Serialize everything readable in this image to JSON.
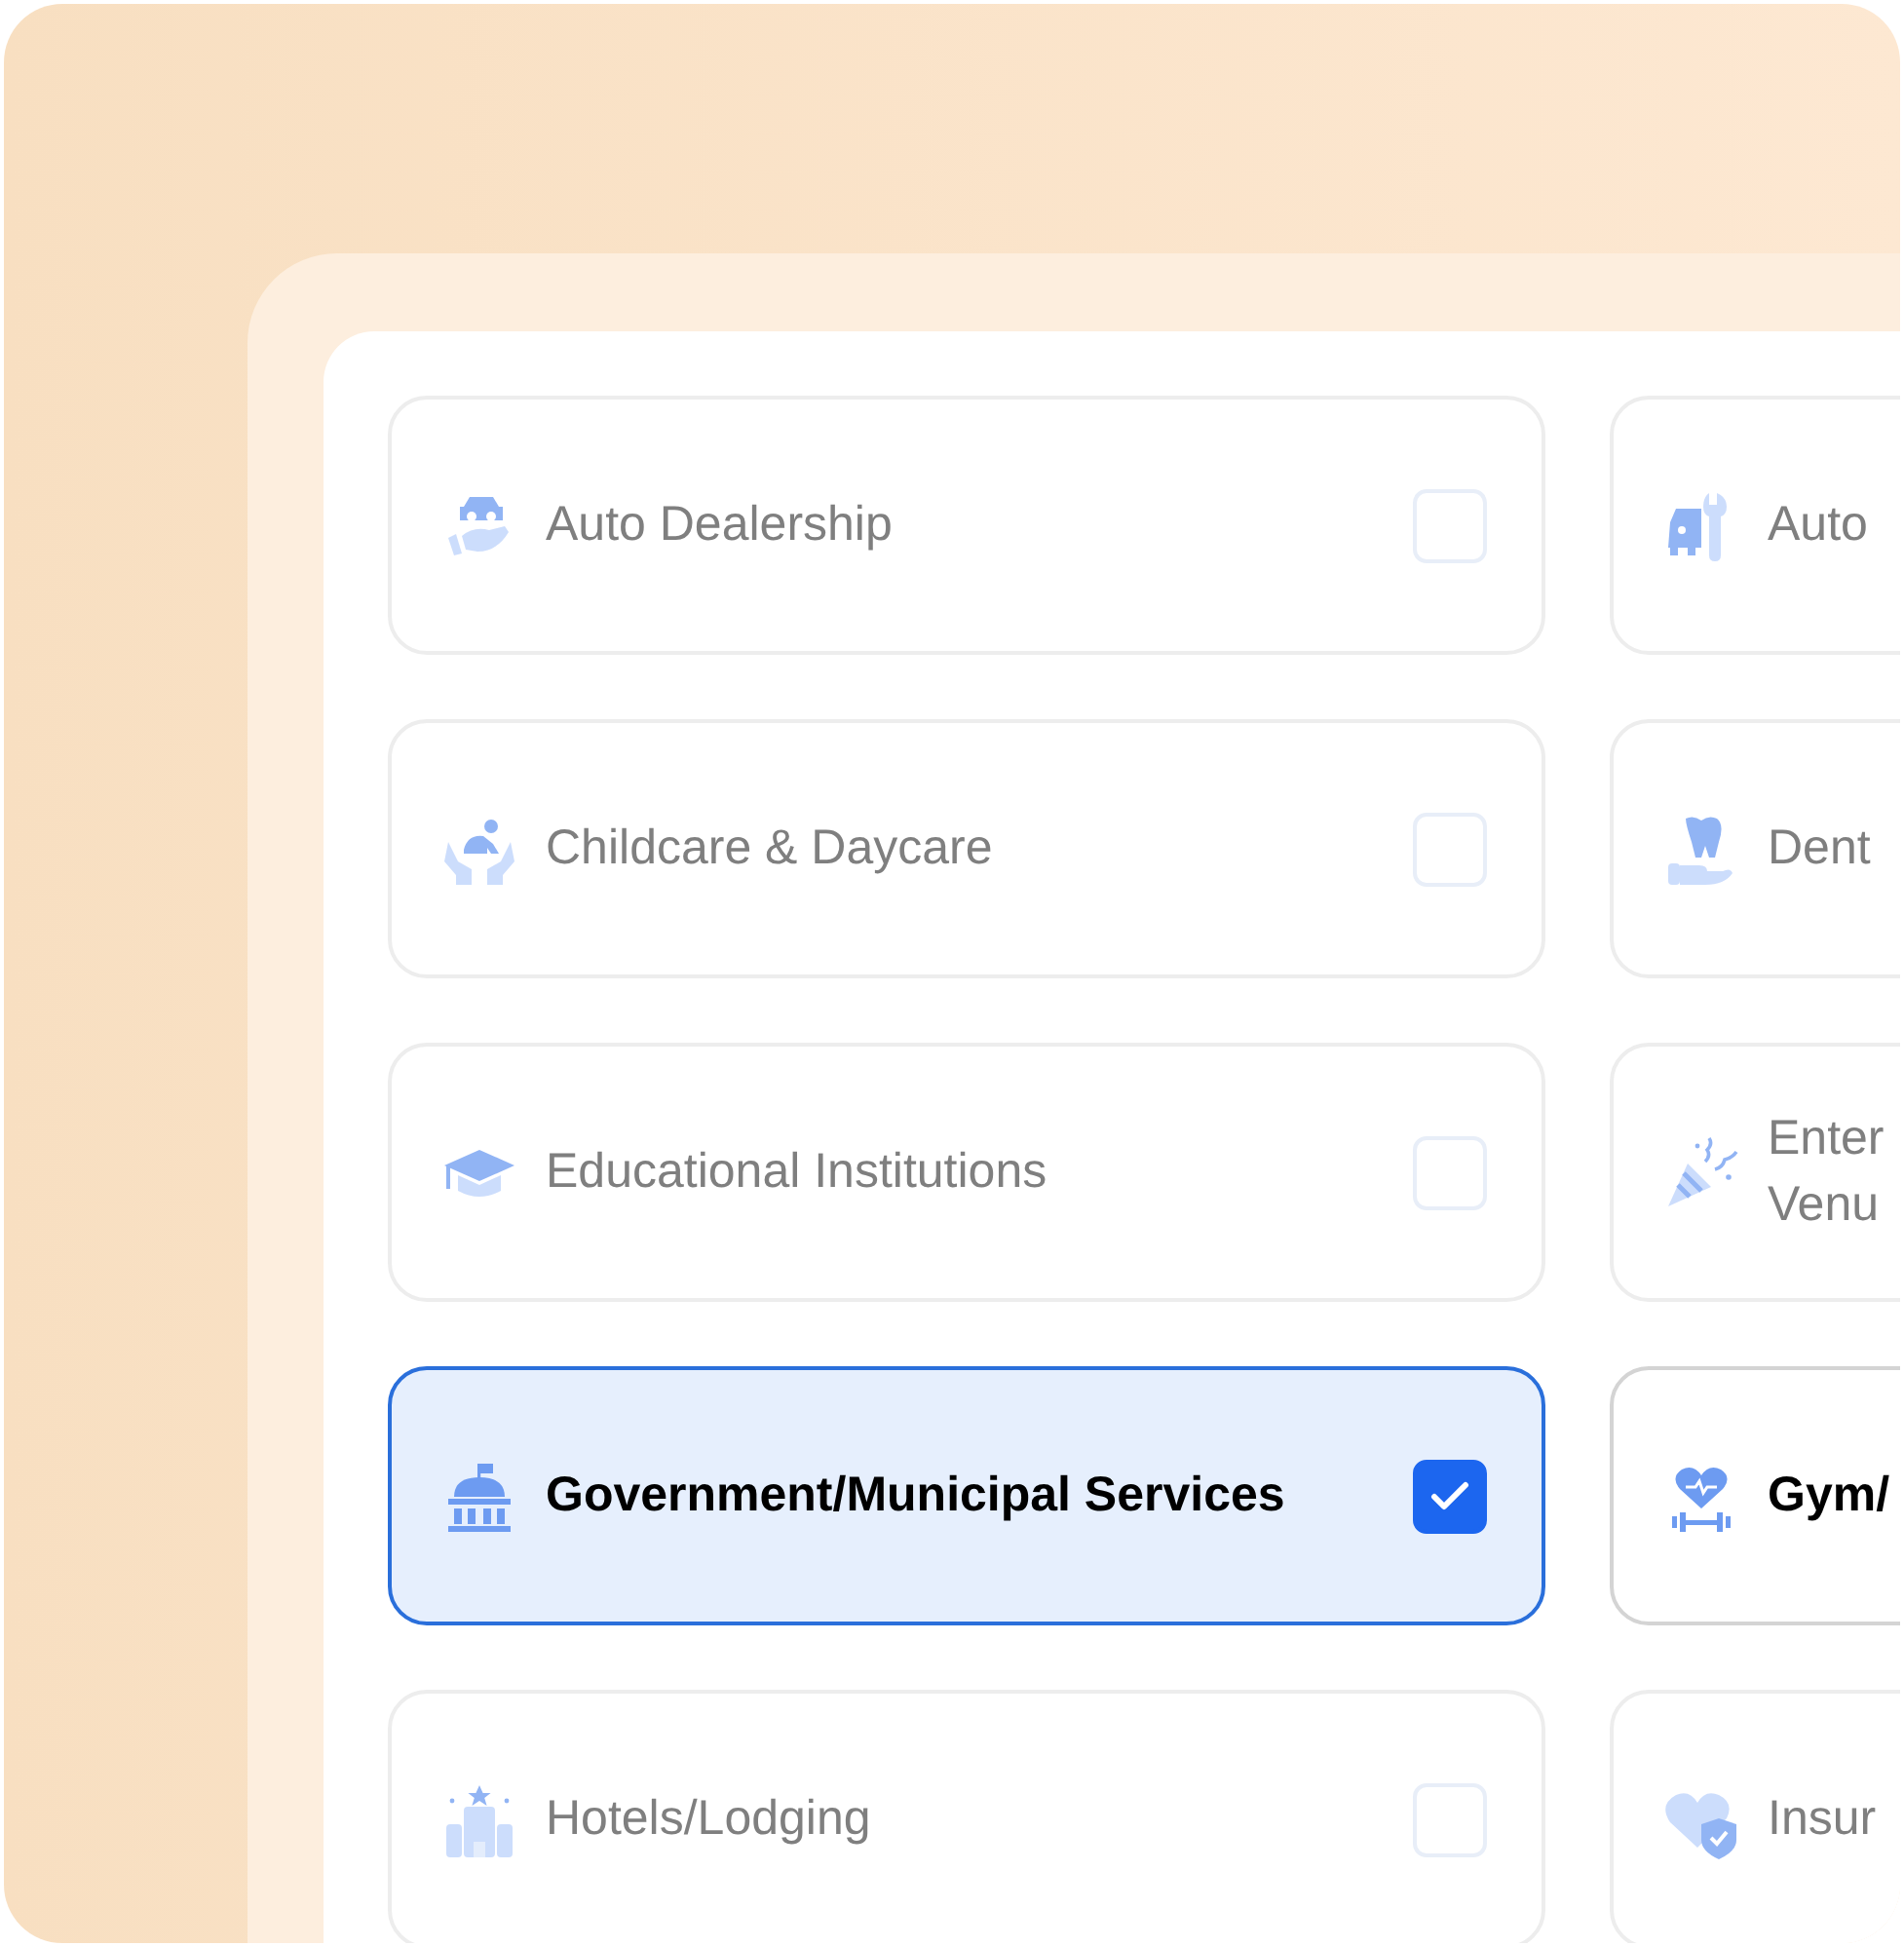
{
  "rows": [
    {
      "cards": [
        {
          "label": "Auto Dealership",
          "checked": false,
          "highlighted": false
        },
        {
          "label": "Auto",
          "highlighted": false
        }
      ]
    },
    {
      "cards": [
        {
          "label": "Childcare & Daycare",
          "checked": false,
          "highlighted": false
        },
        {
          "label": "Dent",
          "highlighted": false
        }
      ]
    },
    {
      "cards": [
        {
          "label": "Educational Institutions",
          "checked": false,
          "highlighted": false
        },
        {
          "label": "Enter\nVenu",
          "highlighted": false
        }
      ]
    },
    {
      "cards": [
        {
          "label": "Government/Municipal Services",
          "checked": true,
          "highlighted": true
        },
        {
          "label": "Gym/",
          "highlighted": true
        }
      ]
    },
    {
      "cards": [
        {
          "label": "Hotels/Lodging",
          "checked": false,
          "highlighted": false
        },
        {
          "label": "Insur",
          "highlighted": false
        }
      ]
    }
  ]
}
